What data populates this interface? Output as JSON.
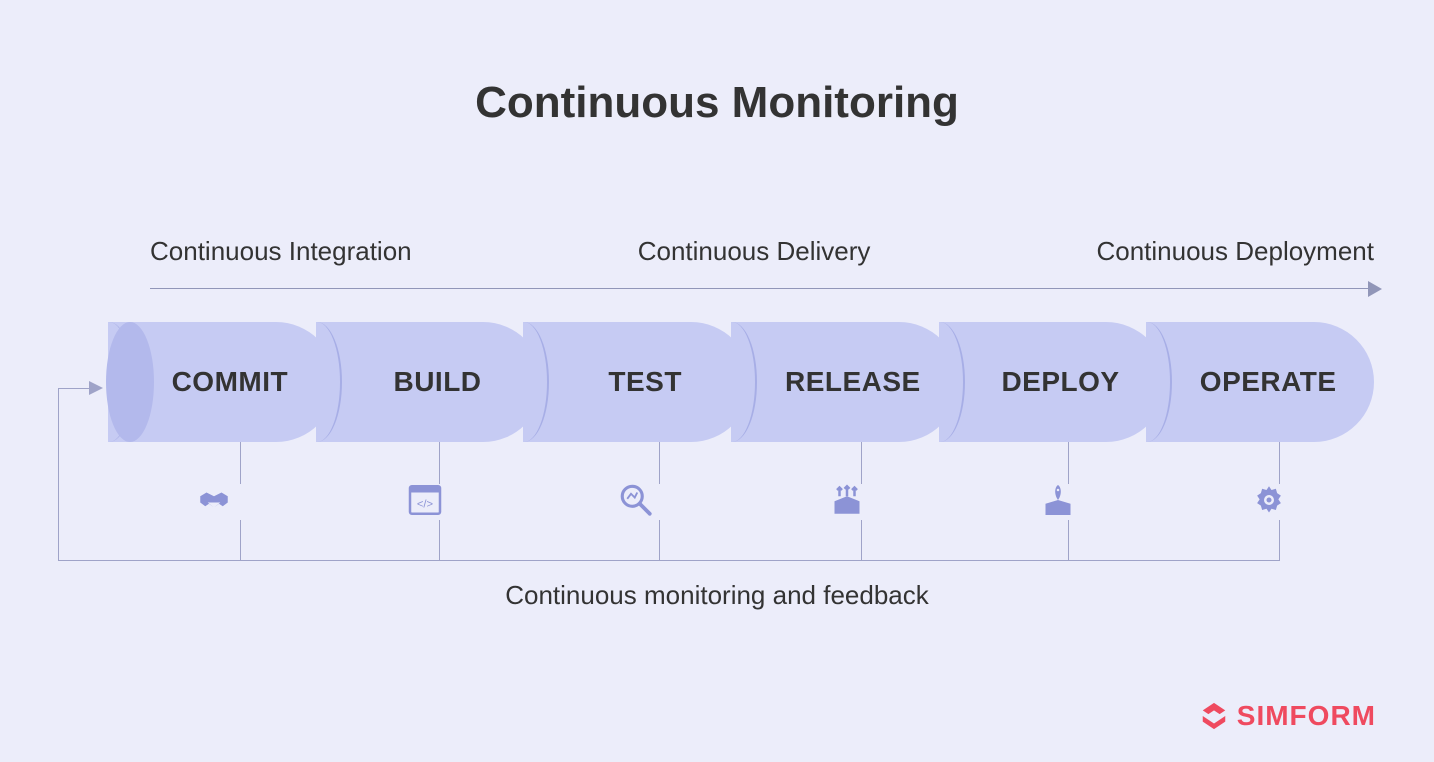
{
  "title": "Continuous Monitoring",
  "phases": {
    "integration": "Continuous Integration",
    "delivery": "Continuous Delivery",
    "deployment": "Continuous Deployment"
  },
  "stages": [
    {
      "label": "COMMIT",
      "icon": "handshake-icon"
    },
    {
      "label": "BUILD",
      "icon": "code-window-icon"
    },
    {
      "label": "TEST",
      "icon": "magnifier-analytics-icon"
    },
    {
      "label": "RELEASE",
      "icon": "box-arrows-up-icon"
    },
    {
      "label": "DEPLOY",
      "icon": "box-rocket-icon"
    },
    {
      "label": "OPERATE",
      "icon": "gear-icon"
    }
  ],
  "feedback_label": "Continuous monitoring and feedback",
  "brand": "SIMFORM",
  "colors": {
    "background": "#ecedfa",
    "segment": "#c6cbf3",
    "segment_cap": "#b3b9ec",
    "icon": "#8c93d6",
    "brand": "#ef4a5f"
  }
}
